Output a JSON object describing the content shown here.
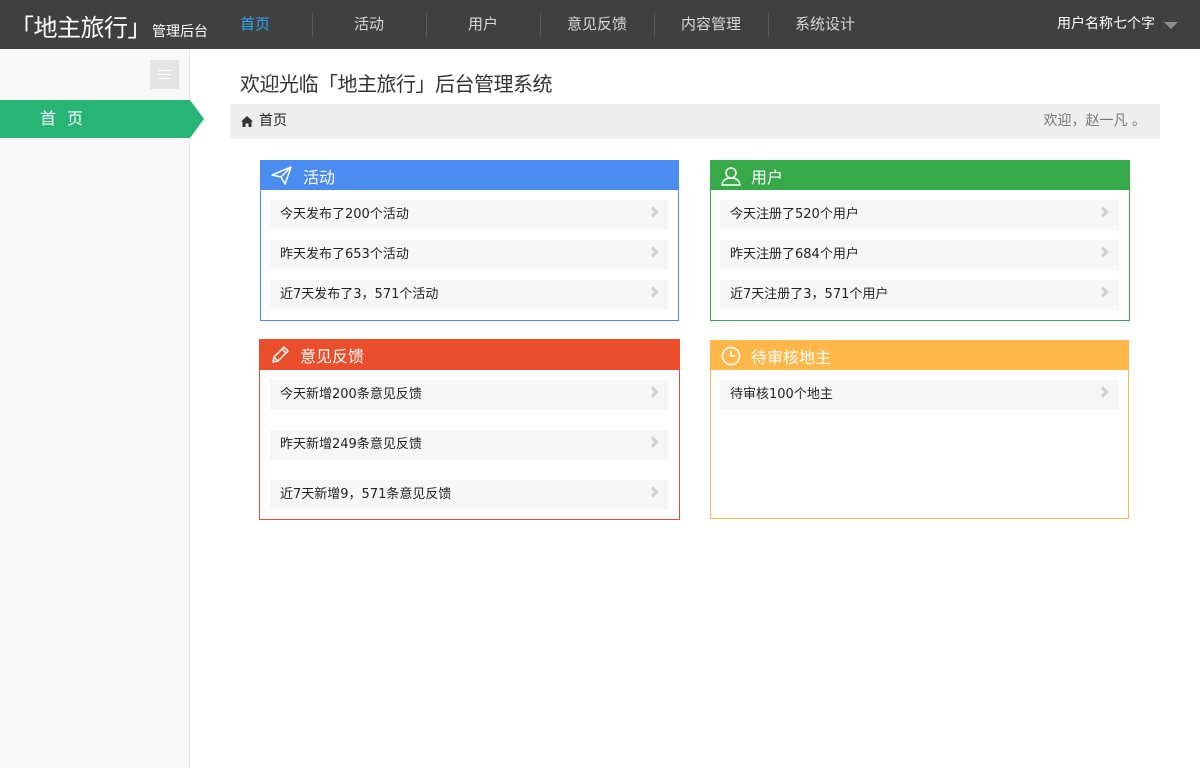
{
  "header": {
    "logo_main": "「地主旅行」",
    "logo_sub": "管理后台",
    "nav": [
      {
        "label": "首页",
        "active": true
      },
      {
        "label": "活动",
        "active": false
      },
      {
        "label": "用户",
        "active": false
      },
      {
        "label": "意见反馈",
        "active": false
      },
      {
        "label": "内容管理",
        "active": false
      },
      {
        "label": "系统设计",
        "active": false
      }
    ],
    "user_name": "用户名称七个字",
    "active_color": "#2aa7f0"
  },
  "sidebar": {
    "home_label": "首 页",
    "accent": "#27b576"
  },
  "main": {
    "welcome": "欢迎光临「地主旅行」后台管理系统",
    "breadcrumb": "首页",
    "greeting": "欢迎，赵一凡 。",
    "panels": {
      "activity": {
        "title": "活动",
        "icon": "paper-plane-icon",
        "color": "#4a8cf0",
        "rows": [
          "今天发布了200个活动",
          "昨天发布了653个活动",
          "近7天发布了3，571个活动"
        ]
      },
      "users": {
        "title": "用户",
        "icon": "user-icon",
        "color": "#36a948",
        "rows": [
          "今天注册了520个用户",
          "昨天注册了684个用户",
          "近7天注册了3，571个用户"
        ]
      },
      "feedback": {
        "title": "意见反馈",
        "icon": "pencil-icon",
        "color": "#eb4e2b",
        "rows": [
          "今天新增200条意见反馈",
          "昨天新增249条意见反馈",
          "近7天新增9，571条意见反馈"
        ]
      },
      "pending": {
        "title": "待审核地主",
        "icon": "clock-icon",
        "color": "#ffb74a",
        "rows": [
          "待审核100个地主"
        ]
      }
    }
  }
}
